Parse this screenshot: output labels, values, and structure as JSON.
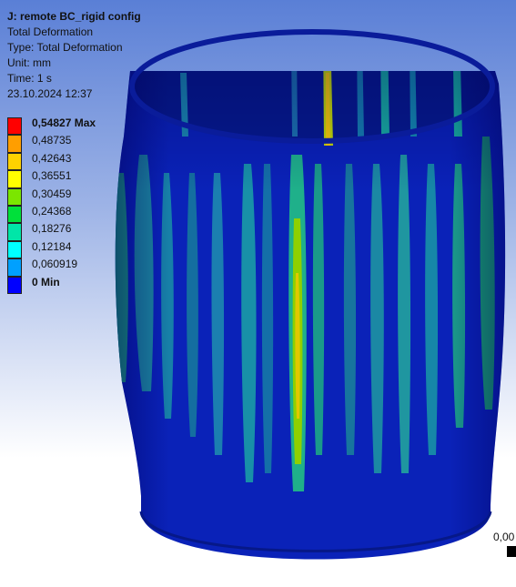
{
  "result": {
    "title": "J: remote BC_rigid config",
    "result_name": "Total Deformation",
    "type_line": "Type: Total Deformation",
    "unit_line": "Unit: mm",
    "time_line": "Time: 1 s",
    "date_line": "23.10.2024 12:37"
  },
  "legend": [
    {
      "label": "0,54827 Max",
      "color": "#ff0000",
      "bold": true
    },
    {
      "label": "0,48735",
      "color": "#ff9e00"
    },
    {
      "label": "0,42643",
      "color": "#ffd200"
    },
    {
      "label": "0,36551",
      "color": "#ffff00"
    },
    {
      "label": "0,30459",
      "color": "#7be600"
    },
    {
      "label": "0,24368",
      "color": "#00e03a"
    },
    {
      "label": "0,18276",
      "color": "#00e6a8"
    },
    {
      "label": "0,12184",
      "color": "#00ffff"
    },
    {
      "label": "0,060919",
      "color": "#00a0ff"
    },
    {
      "label": "0 Min",
      "color": "#0000ff",
      "bold": true
    }
  ],
  "scale": {
    "label": "0,00"
  }
}
